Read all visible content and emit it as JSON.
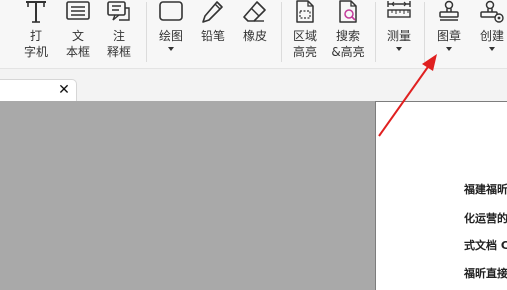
{
  "toolbar": {
    "tools": [
      {
        "id": "typewriter",
        "line1": "打",
        "line2": "字机",
        "icon": "typewriter-icon"
      },
      {
        "id": "textbox",
        "line1": "文",
        "line2": "本框",
        "icon": "textbox-icon"
      },
      {
        "id": "note",
        "line1": "注",
        "line2": "释框",
        "icon": "note-icon"
      },
      {
        "id": "drawing",
        "line1": "绘图",
        "icon": "rectangle-icon",
        "dropdown": true
      },
      {
        "id": "pencil",
        "line1": "铅笔",
        "icon": "pencil-icon"
      },
      {
        "id": "eraser",
        "line1": "橡皮",
        "icon": "eraser-icon"
      },
      {
        "id": "area-highlight",
        "line1": "区域",
        "line2": "高亮",
        "icon": "area-highlight-icon"
      },
      {
        "id": "search-highlight",
        "line1": "搜索",
        "line2": "&高亮",
        "icon": "search-highlight-icon"
      },
      {
        "id": "measure",
        "line1": "测量",
        "icon": "ruler-icon",
        "dropdown": true
      },
      {
        "id": "stamp",
        "line1": "图章",
        "icon": "stamp-icon",
        "dropdown": true
      },
      {
        "id": "create",
        "line1": "创建",
        "icon": "stamp-settings-icon",
        "dropdown": true
      }
    ]
  },
  "tabs": {
    "close_symbol": "✕"
  },
  "document": {
    "lines": [
      "福建福昕",
      "化运营的",
      "式文档 C",
      "福昕直接"
    ]
  },
  "annotation": {
    "arrow_color": "#e02020",
    "points_to": "stamp"
  }
}
